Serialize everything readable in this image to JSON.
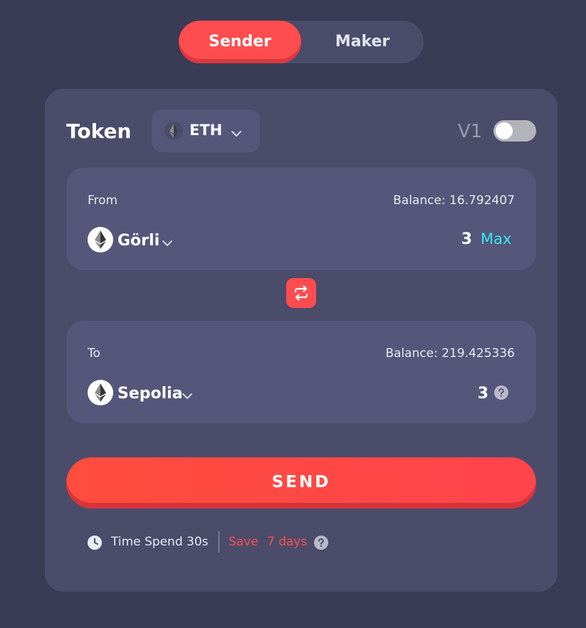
{
  "mode_switch": {
    "sender_label": "Sender",
    "maker_label": "Maker",
    "active": "Sender"
  },
  "token": {
    "label": "Token",
    "selected": "ETH",
    "icon": "ethereum-icon"
  },
  "version": {
    "label": "V1",
    "enabled": false
  },
  "from": {
    "label": "From",
    "balance": "Balance: 16.792407",
    "chain": "Görli",
    "chain_icon": "ethereum-icon",
    "amount": "3",
    "max_label": "Max"
  },
  "to": {
    "label": "To",
    "balance": "Balance: 219.425336",
    "chain": "Sepolia",
    "chain_icon": "ethereum-icon",
    "amount": "3"
  },
  "send_button": "SEND",
  "footer": {
    "time_spend": "Time Spend 30s",
    "save_label": "Save",
    "save_days": "7 days"
  },
  "colors": {
    "background": "#3a3b55",
    "card": "#4b4c6a",
    "panel": "#55567a",
    "accent": "#ff4d4f",
    "max_link": "#34e8f2"
  }
}
